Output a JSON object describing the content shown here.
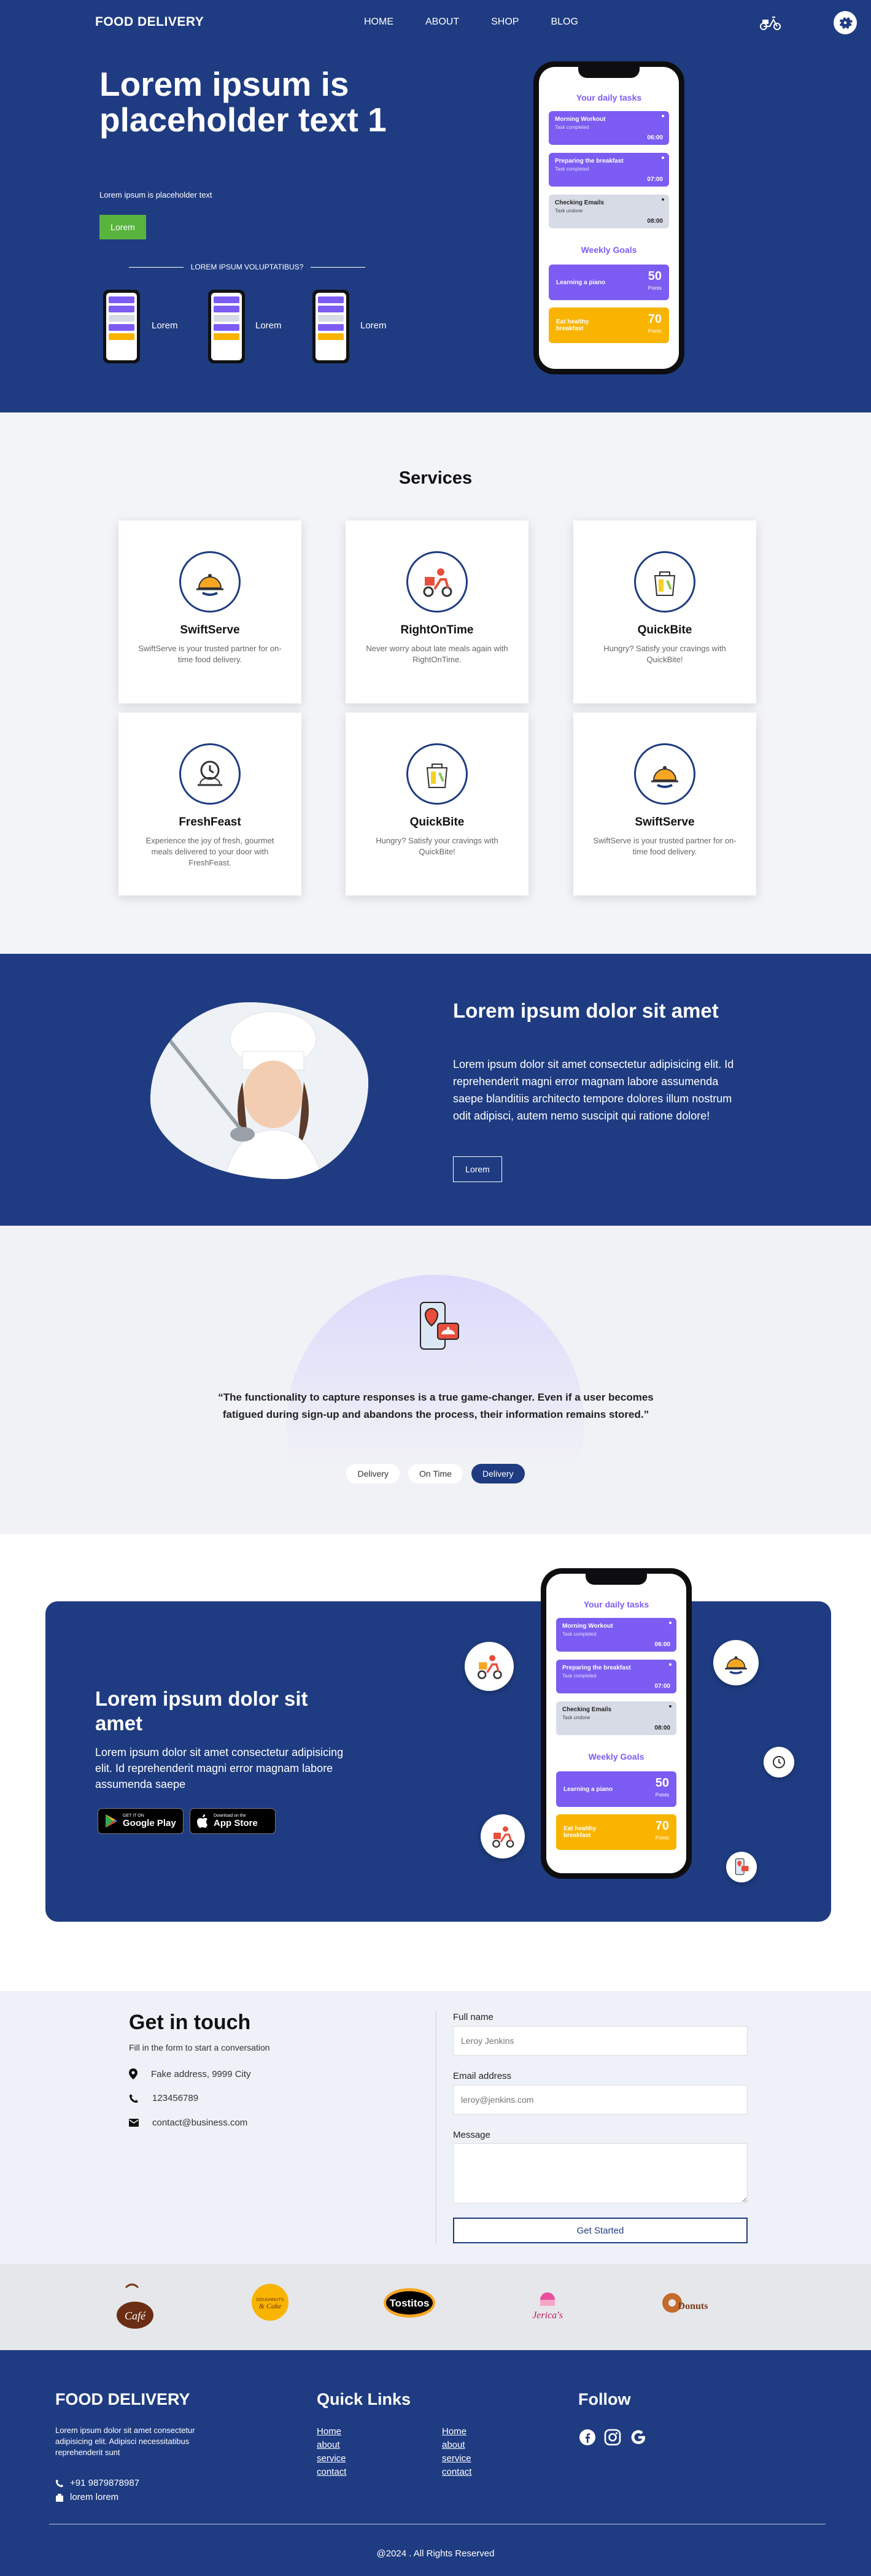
{
  "nav": {
    "brand": "FOOD DELIVERY",
    "links": [
      "HOME",
      "ABOUT",
      "SHOP",
      "BLOG"
    ]
  },
  "hero": {
    "title": "Lorem ipsum is placeholder text 1",
    "subtitle": "Lorem ipsum is placeholder text",
    "button": "Lorem",
    "divider_text": "LOREM IPSUM VOLUPTATIBUS?",
    "mini_labels": [
      "Lorem",
      "Lorem",
      "Lorem"
    ]
  },
  "phone": {
    "header": "Your daily tasks",
    "tasks": [
      {
        "title": "Morning Workout",
        "status": "Task completed",
        "time": "06:00"
      },
      {
        "title": "Preparing the breakfast",
        "status": "Task completed",
        "time": "07:00"
      },
      {
        "title": "Checking Emails",
        "status": "Task undone",
        "time": "08:00"
      }
    ],
    "goals_title": "Weekly Goals",
    "goals": [
      {
        "label": "Learning a piano",
        "value": "50",
        "unit": "Points"
      },
      {
        "label": "Eat healthy breakfast",
        "value": "70",
        "unit": "Points"
      }
    ]
  },
  "services": {
    "title": "Services",
    "cards": [
      {
        "title": "SwiftServe",
        "desc": "SwiftServe is your trusted partner for on-time food delivery.",
        "icon": "cloche-icon"
      },
      {
        "title": "RightOnTime",
        "desc": "Never worry about late meals again with RightOnTime.",
        "icon": "scooter-delivery-icon"
      },
      {
        "title": "QuickBite",
        "desc": "Hungry? Satisfy your cravings with QuickBite!",
        "icon": "food-bag-icon"
      },
      {
        "title": "FreshFeast",
        "desc": "Experience the joy of fresh, gourmet meals delivered to your door with FreshFeast.",
        "icon": "timer-cloche-icon"
      },
      {
        "title": "QuickBite",
        "desc": "Hungry? Satisfy your cravings with QuickBite!",
        "icon": "food-bag-icon"
      },
      {
        "title": "SwiftServe",
        "desc": "SwiftServe is your trusted partner for on-time food delivery.",
        "icon": "cloche-icon"
      }
    ]
  },
  "chef": {
    "title": "Lorem ipsum dolor sit amet",
    "text": "Lorem ipsum dolor sit amet consectetur adipisicing elit. Id reprehenderit magni error magnam labore assumenda saepe blanditiis architecto tempore dolores illum nostrum odit adipisci, autem nemo suscipit qui ratione dolore!",
    "button": "Lorem"
  },
  "testimonial": {
    "quote": "“The functionality to capture responses is a true game-changer. Even if a user becomes fatigued during sign-up and abandons the process, their information remains stored.”",
    "pills": [
      "Delivery",
      "On Time",
      "Delivery"
    ],
    "active_pill": 2
  },
  "app": {
    "title": "Lorem ipsum dolor sit amet",
    "text": "Lorem ipsum dolor sit amet consectetur adipisicing elit. Id reprehenderit magni error magnam labore assumenda saepe",
    "google_small": "GET IT ON",
    "google_big": "Google Play",
    "apple_small": "Download on the",
    "apple_big": "App Store"
  },
  "contact": {
    "title": "Get in touch",
    "subtitle": "Fill in the form to start a conversation",
    "address": "Fake address, 9999 City",
    "phone": "123456789",
    "email": "contact@business.com",
    "form": {
      "name_label": "Full name",
      "name_placeholder": "Leroy Jenkins",
      "email_label": "Email address",
      "email_placeholder": "leroy@jenkins.com",
      "message_label": "Message",
      "submit": "Get Started"
    }
  },
  "logos": [
    "Café",
    "Doughnuts & Cake",
    "Tostitos",
    "Jerica's",
    "Donuts"
  ],
  "footer": {
    "brand": "FOOD DELIVERY",
    "desc": "Lorem ipsum dolor sit amet consectetur adipisicing elit. Adipisci necessitatibus reprehenderit sunt",
    "phone": "+91 9879878987",
    "address": "lorem lorem",
    "quick_title": "Quick Links",
    "links_col1": [
      "Home",
      "about",
      "service",
      "contact"
    ],
    "links_col2": [
      "Home",
      "about",
      "service",
      "contact"
    ],
    "follow_title": "Follow",
    "copyright": "@2024 . All Rights Reserved"
  },
  "colors": {
    "navy": "#1f3c82",
    "purple": "#7c5cf2",
    "yellow": "#f9b400",
    "green": "#59b33f"
  }
}
